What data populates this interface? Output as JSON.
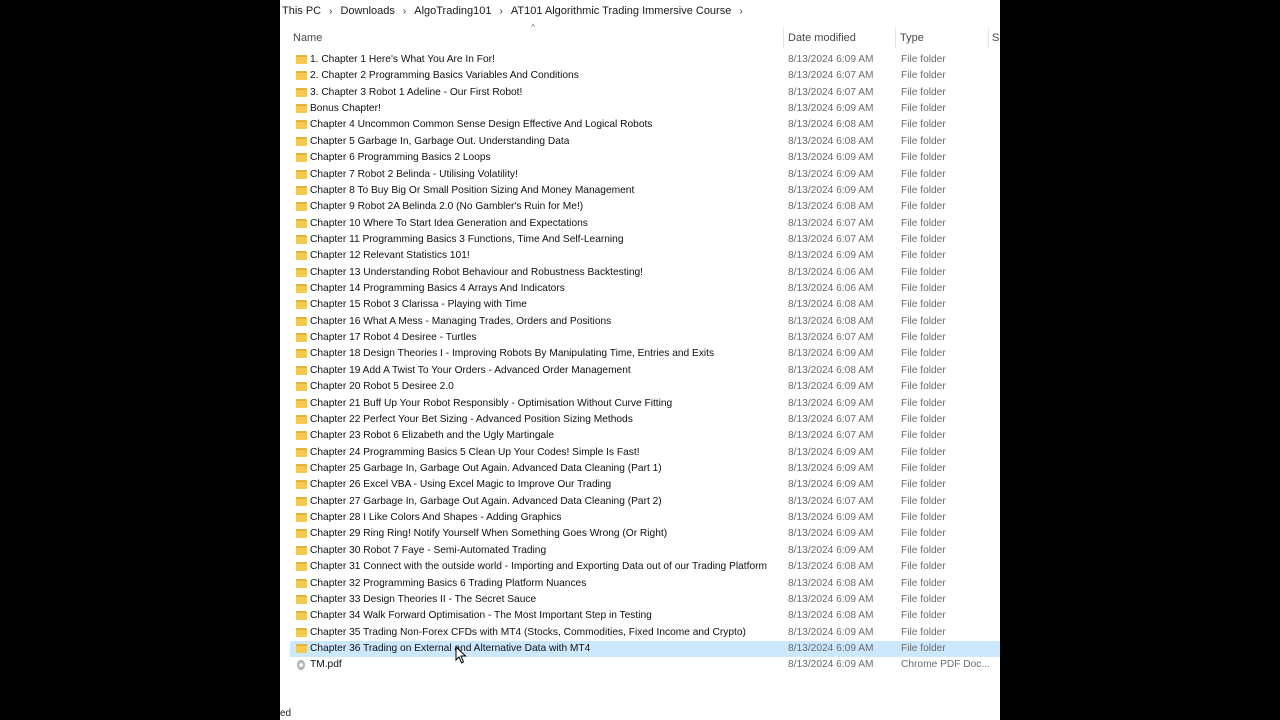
{
  "breadcrumb": [
    "This PC",
    "Downloads",
    "AlgoTrading101",
    "AT101 Algorithmic Trading Immersive Course"
  ],
  "breadcrumb_separator": "›",
  "columns": {
    "name": "Name",
    "date": "Date modified",
    "type": "Type",
    "size": "Si"
  },
  "status_text": "ed",
  "files": [
    {
      "name": "1. Chapter 1  Here's What You Are In For!",
      "date": "8/13/2024 6:09 AM",
      "type": "File folder",
      "icon": "folder-icon"
    },
    {
      "name": "2. Chapter 2  Programming Basics Variables And Conditions",
      "date": "8/13/2024 6:07 AM",
      "type": "File folder",
      "icon": "folder-icon"
    },
    {
      "name": "3. Chapter 3  Robot 1 Adeline - Our First Robot!",
      "date": "8/13/2024 6:07 AM",
      "type": "File folder",
      "icon": "folder-icon"
    },
    {
      "name": "Bonus Chapter!",
      "date": "8/13/2024 6:09 AM",
      "type": "File folder",
      "icon": "folder-icon"
    },
    {
      "name": "Chapter 4  Uncommon Common Sense Design Effective And Logical Robots",
      "date": "8/13/2024 6:08 AM",
      "type": "File folder",
      "icon": "folder-icon"
    },
    {
      "name": "Chapter 5  Garbage In, Garbage Out. Understanding Data",
      "date": "8/13/2024 6:08 AM",
      "type": "File folder",
      "icon": "folder-icon"
    },
    {
      "name": "Chapter 6  Programming Basics 2 Loops",
      "date": "8/13/2024 6:09 AM",
      "type": "File folder",
      "icon": "folder-icon"
    },
    {
      "name": "Chapter 7  Robot 2 Belinda - Utilising Volatility!",
      "date": "8/13/2024 6:09 AM",
      "type": "File folder",
      "icon": "folder-icon"
    },
    {
      "name": "Chapter 8  To Buy Big Or Small Position Sizing And Money Management",
      "date": "8/13/2024 6:09 AM",
      "type": "File folder",
      "icon": "folder-icon"
    },
    {
      "name": "Chapter 9  Robot 2A Belinda 2.0 (No Gambler's Ruin for Me!)",
      "date": "8/13/2024 6:08 AM",
      "type": "File folder",
      "icon": "folder-icon"
    },
    {
      "name": "Chapter 10  Where To Start Idea Generation and Expectations",
      "date": "8/13/2024 6:07 AM",
      "type": "File folder",
      "icon": "folder-icon"
    },
    {
      "name": "Chapter 11  Programming Basics 3 Functions, Time And Self-Learning",
      "date": "8/13/2024 6:07 AM",
      "type": "File folder",
      "icon": "folder-icon"
    },
    {
      "name": "Chapter 12  Relevant Statistics 101!",
      "date": "8/13/2024 6:09 AM",
      "type": "File folder",
      "icon": "folder-icon"
    },
    {
      "name": "Chapter 13  Understanding Robot Behaviour and Robustness Backtesting!",
      "date": "8/13/2024 6:06 AM",
      "type": "File folder",
      "icon": "folder-icon"
    },
    {
      "name": "Chapter 14  Programming Basics 4 Arrays And Indicators",
      "date": "8/13/2024 6:06 AM",
      "type": "File folder",
      "icon": "folder-icon"
    },
    {
      "name": "Chapter 15  Robot 3 Clarissa - Playing with Time",
      "date": "8/13/2024 6:08 AM",
      "type": "File folder",
      "icon": "folder-icon"
    },
    {
      "name": "Chapter 16  What A Mess - Managing Trades, Orders and Positions",
      "date": "8/13/2024 6:08 AM",
      "type": "File folder",
      "icon": "folder-icon"
    },
    {
      "name": "Chapter 17  Robot 4 Desiree - Turtles",
      "date": "8/13/2024 6:07 AM",
      "type": "File folder",
      "icon": "folder-icon"
    },
    {
      "name": "Chapter 18  Design Theories I - Improving Robots By Manipulating Time, Entries and Exits",
      "date": "8/13/2024 6:09 AM",
      "type": "File folder",
      "icon": "folder-icon"
    },
    {
      "name": "Chapter 19  Add A Twist To Your Orders - Advanced Order Management",
      "date": "8/13/2024 6:08 AM",
      "type": "File folder",
      "icon": "folder-icon"
    },
    {
      "name": "Chapter 20  Robot 5 Desiree 2.0",
      "date": "8/13/2024 6:09 AM",
      "type": "File folder",
      "icon": "folder-icon"
    },
    {
      "name": "Chapter 21  Buff Up Your Robot Responsibly - Optimisation Without Curve Fitting",
      "date": "8/13/2024 6:09 AM",
      "type": "File folder",
      "icon": "folder-icon"
    },
    {
      "name": "Chapter 22  Perfect Your Bet Sizing - Advanced Position Sizing Methods",
      "date": "8/13/2024 6:07 AM",
      "type": "File folder",
      "icon": "folder-icon"
    },
    {
      "name": "Chapter 23  Robot 6 Elizabeth and the Ugly Martingale",
      "date": "8/13/2024 6:07 AM",
      "type": "File folder",
      "icon": "folder-icon"
    },
    {
      "name": "Chapter 24  Programming Basics 5 Clean Up Your Codes! Simple Is Fast!",
      "date": "8/13/2024 6:09 AM",
      "type": "File folder",
      "icon": "folder-icon"
    },
    {
      "name": "Chapter 25  Garbage In, Garbage Out Again. Advanced Data Cleaning (Part 1)",
      "date": "8/13/2024 6:09 AM",
      "type": "File folder",
      "icon": "folder-icon"
    },
    {
      "name": "Chapter 26  Excel VBA - Using Excel Magic to Improve Our Trading",
      "date": "8/13/2024 6:09 AM",
      "type": "File folder",
      "icon": "folder-icon"
    },
    {
      "name": "Chapter 27  Garbage In, Garbage Out Again. Advanced Data Cleaning (Part 2)",
      "date": "8/13/2024 6:07 AM",
      "type": "File folder",
      "icon": "folder-icon"
    },
    {
      "name": "Chapter 28  I Like Colors And Shapes - Adding Graphics",
      "date": "8/13/2024 6:09 AM",
      "type": "File folder",
      "icon": "folder-icon"
    },
    {
      "name": "Chapter 29  Ring Ring! Notify Yourself When Something Goes Wrong (Or Right)",
      "date": "8/13/2024 6:09 AM",
      "type": "File folder",
      "icon": "folder-icon"
    },
    {
      "name": "Chapter 30  Robot 7 Faye - Semi-Automated Trading",
      "date": "8/13/2024 6:09 AM",
      "type": "File folder",
      "icon": "folder-icon"
    },
    {
      "name": "Chapter 31  Connect with the outside world - Importing and Exporting Data out of our Trading Platform",
      "date": "8/13/2024 6:08 AM",
      "type": "File folder",
      "icon": "folder-icon"
    },
    {
      "name": "Chapter 32  Programming Basics 6 Trading Platform Nuances",
      "date": "8/13/2024 6:08 AM",
      "type": "File folder",
      "icon": "folder-icon"
    },
    {
      "name": "Chapter 33  Design Theories II - The Secret Sauce",
      "date": "8/13/2024 6:09 AM",
      "type": "File folder",
      "icon": "folder-icon"
    },
    {
      "name": "Chapter 34  Walk Forward Optimisation - The Most Important Step in Testing",
      "date": "8/13/2024 6:08 AM",
      "type": "File folder",
      "icon": "folder-icon"
    },
    {
      "name": "Chapter 35  Trading Non-Forex CFDs with MT4 (Stocks, Commodities, Fixed Income and Crypto)",
      "date": "8/13/2024 6:09 AM",
      "type": "File folder",
      "icon": "folder-icon"
    },
    {
      "name": "Chapter 36  Trading on External and Alternative Data with MT4",
      "date": "8/13/2024 6:09 AM",
      "type": "File folder",
      "icon": "folder-icon",
      "selected": true
    },
    {
      "name": "TM.pdf",
      "date": "8/13/2024 6:09 AM",
      "type": "Chrome PDF Doc...",
      "icon": "pdf-icon"
    }
  ]
}
